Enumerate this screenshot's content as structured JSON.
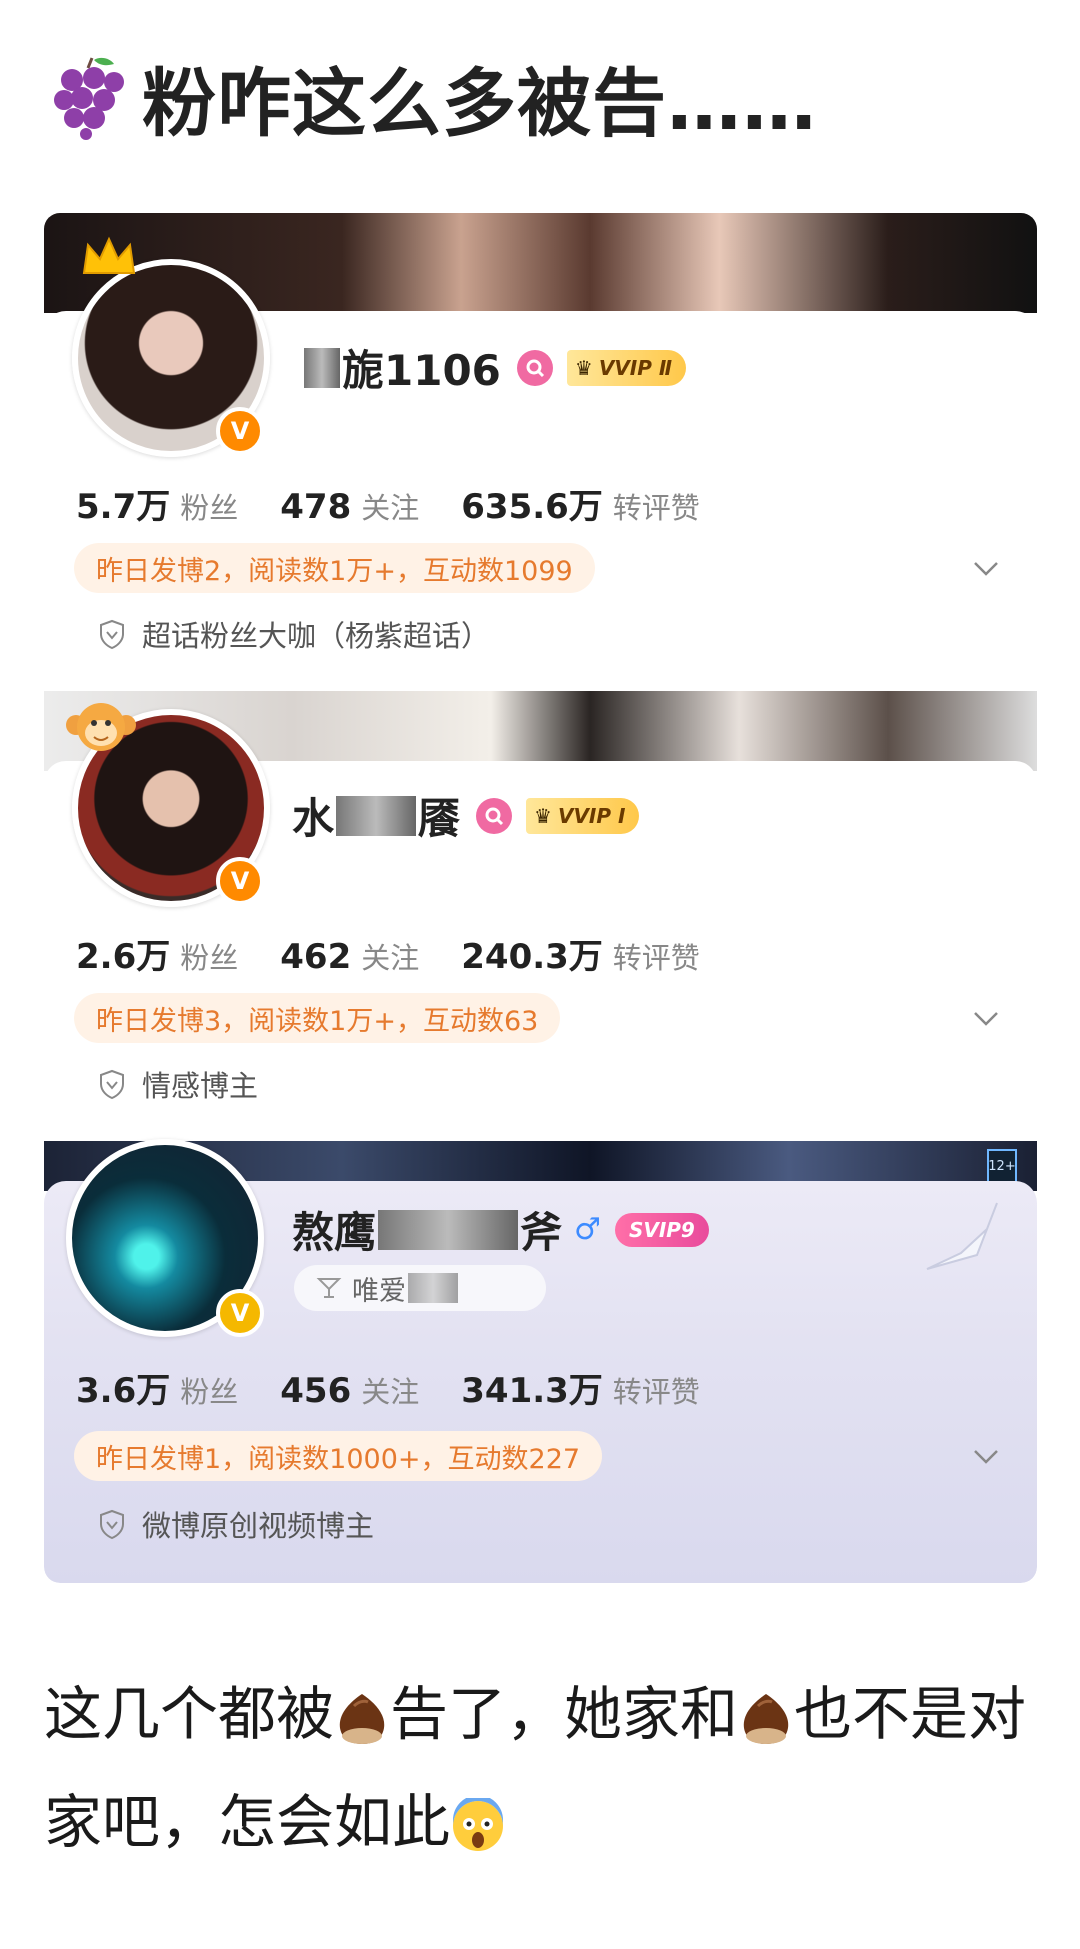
{
  "headline": {
    "emoji_icon": "grape-icon",
    "text": "粉咋这么多被告……"
  },
  "accounts": [
    {
      "name_visible": "旎1106",
      "membership": "VVIP Ⅱ",
      "stats": [
        {
          "value": "5.7万",
          "label": "粉丝"
        },
        {
          "value": "478",
          "label": "关注"
        },
        {
          "value": "635.6万",
          "label": "转评赞"
        }
      ],
      "activity": "昨日发博2，阅读数1万+，互动数1099",
      "tag": "超话粉丝大咖（杨紫超话）"
    },
    {
      "name_prefix": "水",
      "name_suffix": "餍",
      "membership": "VVIP Ⅰ",
      "stats": [
        {
          "value": "2.6万",
          "label": "粉丝"
        },
        {
          "value": "462",
          "label": "关注"
        },
        {
          "value": "240.3万",
          "label": "转评赞"
        }
      ],
      "activity": "昨日发博3，阅读数1万+，互动数63",
      "tag": "情感博主"
    },
    {
      "name_prefix": "熬鹰",
      "name_suffix": "斧",
      "membership": "SVIP9",
      "bio": "唯爱",
      "stats": [
        {
          "value": "3.6万",
          "label": "粉丝"
        },
        {
          "value": "456",
          "label": "关注"
        },
        {
          "value": "341.3万",
          "label": "转评赞"
        }
      ],
      "activity": "昨日发博1，阅读数1000+，互动数227",
      "tag": "微博原创视频博主",
      "age_badge": "12+"
    }
  ],
  "body": {
    "part1": "这几个都被",
    "part2": "告了，她家和",
    "part3": "也不是对家吧，怎会如此"
  },
  "colors": {
    "activity_text": "#e67a2e",
    "activity_bg": "#fff2e6",
    "verified": "#ff8a00",
    "pink_badge": "#f06aa2"
  }
}
